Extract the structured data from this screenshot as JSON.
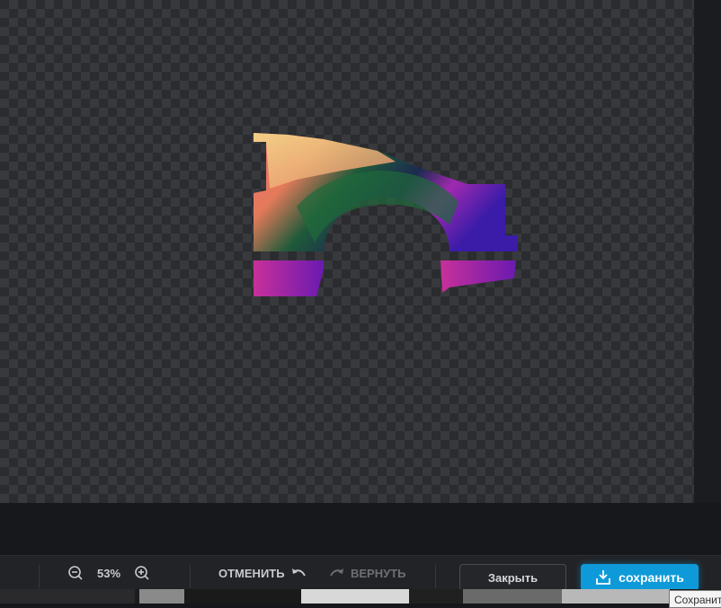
{
  "toolbar": {
    "zoom_out_icon": "zoom-out-icon",
    "zoom_level": "53%",
    "zoom_in_icon": "zoom-in-icon",
    "undo_label": "ОТМЕНИТЬ",
    "redo_label": "ВЕРНУТЬ",
    "close_label": "Закрыть",
    "save_label": "сохранить",
    "save_tooltip": "Сохранить"
  },
  "colors": {
    "accent": "#0e9ad8",
    "toolbar": "#222326"
  }
}
